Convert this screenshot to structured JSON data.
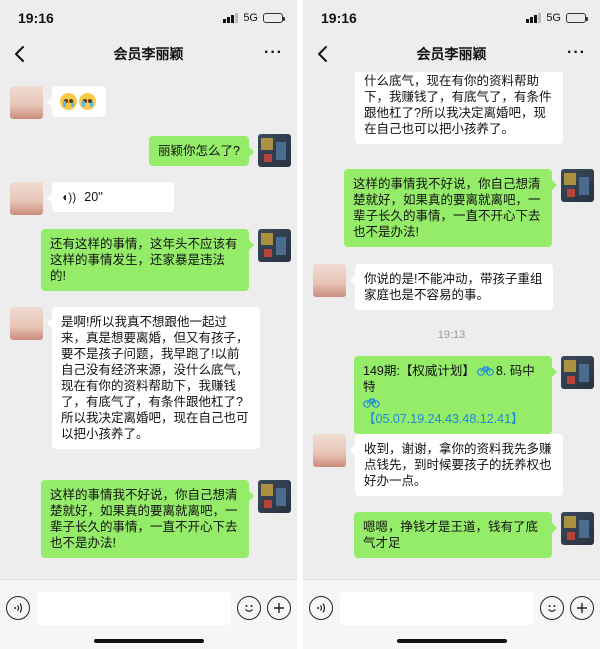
{
  "status": {
    "time": "19:16",
    "network": "5G"
  },
  "chat": {
    "title": "会员李丽颖",
    "more": "···"
  },
  "left": {
    "messages": [
      {
        "from": "peer",
        "type": "emoji",
        "emoji": [
          "crying-face",
          "crying-face"
        ]
      },
      {
        "from": "self",
        "text": "丽颖你怎么了?"
      },
      {
        "from": "peer",
        "type": "voice",
        "duration": "20''"
      },
      {
        "from": "self",
        "text": "还有这样的事情，这年头不应该有这样的事情发生，还家暴是违法的!"
      },
      {
        "from": "peer",
        "text": "是啊!所以我真不想跟他一起过来，真是想要离婚，但又有孩子，要不是孩子问题，我早跑了!以前自己没有经济来源，没什么底气，现在有你的资料帮助下，我赚钱了，有底气了，有条件跟他杠了?所以我决定离婚吧，现在自己也可以把小孩养了。"
      },
      {
        "from": "self",
        "text": "这样的事情我不好说，你自己想清楚就好，如果真的要离就离吧，一辈子长久的事情，一直不开心下去也不是办法!"
      }
    ]
  },
  "right": {
    "messages": [
      {
        "from": "peer",
        "text": "什么底气，现在有你的资料帮助下，我赚钱了，有底气了，有条件跟他杠了?所以我决定离婚吧，现在自己也可以把小孩养了。"
      },
      {
        "from": "self",
        "text": "这样的事情我不好说，你自己想清楚就好，如果真的要离就离吧，一辈子长久的事情，一直不开心下去也不是办法!"
      },
      {
        "from": "peer",
        "text": "你说的是!不能冲动，带孩子重组家庭也是不容易的事。"
      },
      {
        "type": "time",
        "text": "19:13"
      },
      {
        "from": "self",
        "prefix": "149期:【权威计划】",
        "mid": "8. 码中特",
        "numbers": "【05.07.19.24.43.48.12.41】"
      },
      {
        "from": "peer",
        "text": "收到，谢谢，拿你的资料我先多赚点钱先，到时候要孩子的抚养权也好办一点。"
      },
      {
        "from": "self",
        "text": "嗯嗯，挣钱才是王道，钱有了底气才足"
      }
    ]
  },
  "colors": {
    "self_bubble": "#95ec69",
    "peer_bubble": "#ffffff",
    "background": "#ededed",
    "link_blue": "#1e88e5"
  }
}
